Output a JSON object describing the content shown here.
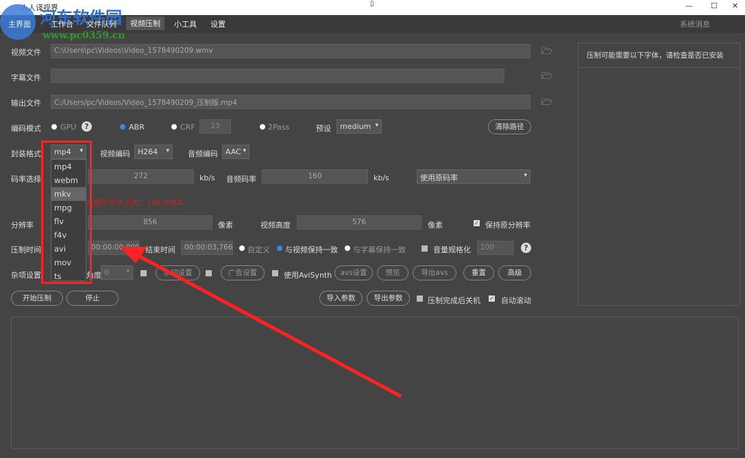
{
  "window": {
    "title": "人人译视界",
    "minimize": "—",
    "maximize": "☐",
    "close": "✕"
  },
  "watermark": {
    "name": "河东软件园",
    "url": "www.pc0359.cn"
  },
  "menu": {
    "items": [
      "主界面",
      "工作台",
      "文件队列",
      "视频压制",
      "小工具",
      "设置"
    ],
    "active": "视频压制",
    "system_msg": "系统消息"
  },
  "form": {
    "video_file_label": "视频文件",
    "video_file": "C:\\Users\\pc\\Videos\\Video_1578490209.wmv",
    "subtitle_file_label": "字幕文件",
    "subtitle_file": "",
    "output_file_label": "输出文件",
    "output_file": "C:/Users/pc/Videos/Video_1578490209_压制版.mp4",
    "encode_mode_label": "编码模式",
    "gpu": "GPU",
    "abr": "ABR",
    "crf": "CRF",
    "crf_value": "23",
    "twopass": "2Pass",
    "preset_label": "预设",
    "preset": "medium",
    "clear_path": "清除路径",
    "container_label": "封装格式",
    "container": "mp4",
    "container_options": [
      "mp4",
      "webm",
      "mkv",
      "mpg",
      "flv",
      "f4v",
      "avi",
      "mov",
      "ts"
    ],
    "highlighted_option": "mkv",
    "video_codec_label": "视频编码",
    "video_codec": "H264",
    "audio_codec_label": "音频编码",
    "audio_codec": "AAC",
    "bitrate_label": "码率选择",
    "video_bitrate": "272",
    "kbs": "kb/s",
    "audio_bitrate_label": "音频码率",
    "audio_bitrate": "160",
    "kbs2": "kb/s",
    "bitrate_mode": "使用原码率",
    "size_note": "视频文件大小为：198.60KB",
    "resolution_label": "分辨率",
    "width": "856",
    "px": "像素",
    "height_label": "视频高度",
    "height": "576",
    "px2": "像素",
    "keep_res": "保持原分辨率",
    "time_label": "压制时间",
    "start_time": "00:00:00,000",
    "end_label": "结束时间",
    "end_time": "00:00:03,766",
    "custom": "自定义",
    "match_video": "与视频保持一致",
    "match_sub": "与字幕保持一致",
    "normalize": "音量规格化",
    "volume": "100",
    "misc_label": "杂项设置",
    "angle_label": "角度",
    "angle": "0",
    "watermark_btn": "水印设置",
    "ad_btn": "广告设置",
    "avisynth": "使用AviSynth",
    "avs_btn": "avs设置",
    "preview_btn": "预览",
    "export_avs": "导出avs",
    "reset": "重置",
    "advanced": "高级",
    "start": "开始压制",
    "stop": "停止",
    "import": "导入参数",
    "export": "导出参数",
    "shutdown": "压制完成后关机",
    "autoscroll": "自动滚动"
  },
  "panel": {
    "header": "压制可能需要以下字体，请检查是否已安装"
  },
  "colors": {
    "accent": "#3a86e8",
    "annotation": "#ff2222",
    "warning": "#cc2222"
  }
}
